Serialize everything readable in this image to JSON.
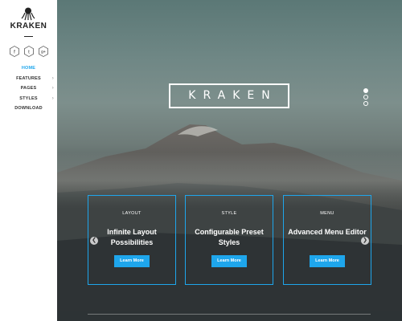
{
  "sidebar": {
    "brand": "KRAKEN",
    "logo_icon": "octopus-icon",
    "socials": [
      {
        "name": "facebook-icon",
        "glyph": "f"
      },
      {
        "name": "twitter-icon",
        "glyph": "t"
      },
      {
        "name": "google-plus-icon",
        "glyph": "g+"
      }
    ],
    "nav": [
      {
        "label": "HOME",
        "active": true,
        "submenu": false
      },
      {
        "label": "FEATURES",
        "active": false,
        "submenu": true
      },
      {
        "label": "PAGES",
        "active": false,
        "submenu": true
      },
      {
        "label": "STYLES",
        "active": false,
        "submenu": true
      },
      {
        "label": "DOWNLOAD",
        "active": false,
        "submenu": false
      }
    ]
  },
  "hero": {
    "title": "KRAKEN",
    "slides_total": 3,
    "slide_active": 1,
    "cards": [
      {
        "label": "LAYOUT",
        "title": "Infinite Layout Possibilities",
        "button": "Learn More"
      },
      {
        "label": "STYLE",
        "title": "Configurable Preset Styles",
        "button": "Learn More"
      },
      {
        "label": "MENU",
        "title": "Advanced Menu Editor",
        "button": "Learn More"
      }
    ],
    "prev_glyph": "❮",
    "next_glyph": "❯"
  },
  "colors": {
    "accent": "#1ea6ec",
    "sidebar_bg": "#ffffff",
    "text_dark": "#222222"
  }
}
